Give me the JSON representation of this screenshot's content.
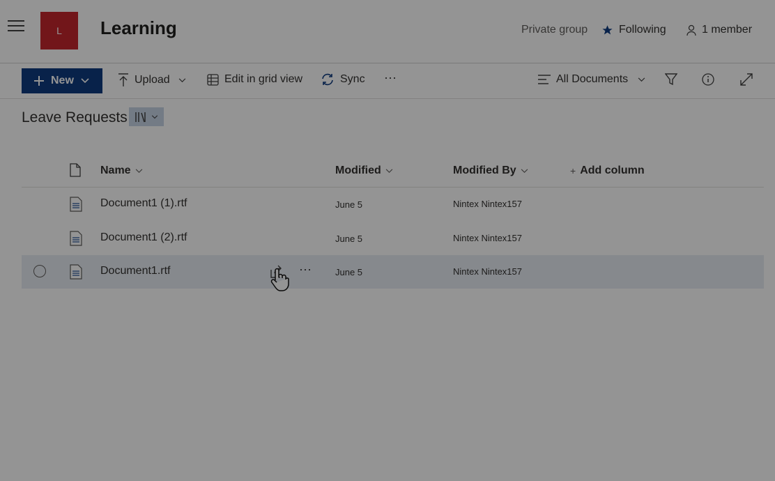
{
  "header": {
    "logo_letter": "L",
    "site_title": "Learning",
    "privacy": "Private group",
    "following_label": "Following",
    "members_label": "1 member"
  },
  "commands": {
    "new_label": "New",
    "upload_label": "Upload",
    "grid_label": "Edit in grid view",
    "sync_label": "Sync",
    "more_label": "···",
    "view_label": "All Documents"
  },
  "library": {
    "title": "Leave Requests"
  },
  "columns": {
    "name": "Name",
    "modified": "Modified",
    "modified_by": "Modified By",
    "add": "Add column"
  },
  "rows": [
    {
      "name": "Document1 (1).rtf",
      "modified": "June 5",
      "modified_by": "Nintex Nintex157"
    },
    {
      "name": "Document1 (2).rtf",
      "modified": "June 5",
      "modified_by": "Nintex Nintex157"
    },
    {
      "name": "Document1.rtf",
      "modified": "June 5",
      "modified_by": "Nintex Nintex157",
      "more": "···"
    }
  ],
  "colors": {
    "accent": "#0f3b80",
    "logo": "#c4262e"
  }
}
